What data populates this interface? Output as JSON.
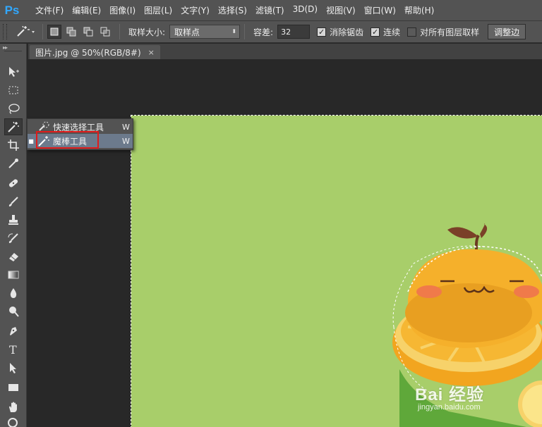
{
  "app": {
    "logo": "Ps",
    "accent": "#31a8ff"
  },
  "menu": [
    "文件(F)",
    "编辑(E)",
    "图像(I)",
    "图层(L)",
    "文字(Y)",
    "选择(S)",
    "滤镜(T)",
    "3D(D)",
    "视图(V)",
    "窗口(W)",
    "帮助(H)"
  ],
  "options": {
    "sample_size_label": "取样大小:",
    "sample_size_value": "取样点",
    "tolerance_label": "容差:",
    "tolerance_value": "32",
    "antialias_label": "消除锯齿",
    "antialias_checked": true,
    "contiguous_label": "连续",
    "contiguous_checked": true,
    "all_layers_label": "对所有图层取样",
    "all_layers_checked": false,
    "refine_edge_label": "调整边"
  },
  "document_tab": {
    "title": "图片.jpg @ 50%(RGB/8#)",
    "close": "×"
  },
  "flyout": {
    "items": [
      {
        "label": "快速选择工具",
        "shortcut": "W",
        "icon": "quick-selection-icon",
        "selected": false
      },
      {
        "label": "魔棒工具",
        "shortcut": "W",
        "icon": "magic-wand-icon",
        "selected": true
      }
    ]
  },
  "tools": [
    "move-icon",
    "marquee-icon",
    "lasso-icon",
    "magic-wand-icon",
    "crop-icon",
    "eyedropper-icon",
    "healing-brush-icon",
    "brush-icon",
    "clone-stamp-icon",
    "history-brush-icon",
    "eraser-icon",
    "gradient-icon",
    "blur-icon",
    "dodge-icon",
    "pen-icon",
    "type-icon",
    "path-selection-icon",
    "rectangle-icon",
    "hand-icon",
    "zoom-icon"
  ],
  "canvas": {
    "background": "#a8ce6a"
  },
  "watermark": {
    "logo": "Bai 经验",
    "url": "jingyan.baidu.com"
  }
}
